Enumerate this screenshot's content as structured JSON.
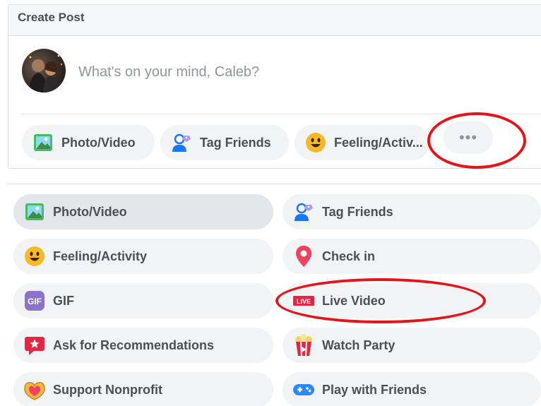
{
  "composer": {
    "title": "Create Post",
    "prompt": "What's on your mind, Caleb?",
    "actions": [
      {
        "label": "Photo/Video",
        "icon": "photo-icon"
      },
      {
        "label": "Tag Friends",
        "icon": "tag-friends-icon"
      },
      {
        "label": "Feeling/Activ...",
        "icon": "smiley-icon"
      }
    ],
    "more_label": "•••"
  },
  "options": [
    {
      "label": "Photo/Video",
      "icon": "photo-icon"
    },
    {
      "label": "Tag Friends",
      "icon": "tag-friends-icon"
    },
    {
      "label": "Feeling/Activity",
      "icon": "smiley-icon"
    },
    {
      "label": "Check in",
      "icon": "location-pin-icon"
    },
    {
      "label": "GIF",
      "icon": "gif-icon",
      "badge": "GIF"
    },
    {
      "label": "Live Video",
      "icon": "live-video-icon",
      "badge": "LIVE"
    },
    {
      "label": "Ask for Recommendations",
      "icon": "recommendation-icon"
    },
    {
      "label": "Watch Party",
      "icon": "popcorn-icon"
    },
    {
      "label": "Support Nonprofit",
      "icon": "nonprofit-heart-icon"
    },
    {
      "label": "Play with Friends",
      "icon": "game-controller-icon"
    }
  ],
  "colors": {
    "annotation": "#e5141b",
    "pill_bg": "#f2f3f5",
    "text": "#4b4f56",
    "placeholder": "#90949c"
  }
}
